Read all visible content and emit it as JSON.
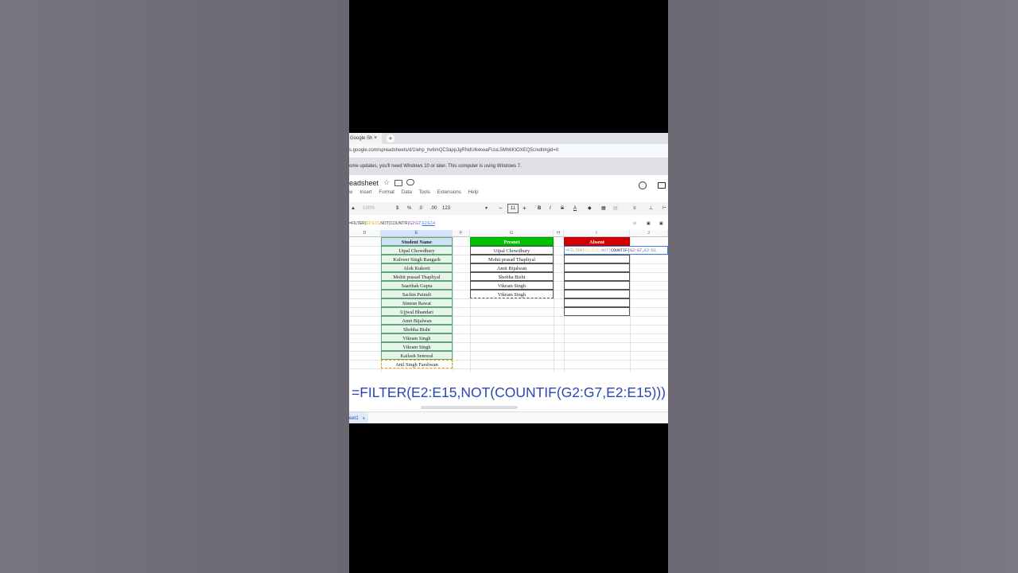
{
  "browser": {
    "tab_label": "Google Sh",
    "tab_close": "×",
    "new_tab": "+",
    "url": "s.google.com/spreadsheets/d/1lehp_hv6mQC3appJgRNdU6xkwaFUuL5Mh6KtOXEQ5c/edit#gid=0",
    "info_message": "ome updates, you'll need Windows 10 or later. This computer is using Windows 7."
  },
  "doc": {
    "title": "eadsheet",
    "star": "☆",
    "menu": [
      "w",
      "Insert",
      "Format",
      "Data",
      "Tools",
      "Extensions",
      "Help"
    ]
  },
  "toolbar": {
    "zoom": "100%",
    "currency": "$",
    "percent": "%",
    "dec_less": ".0",
    "dec_more": ".00",
    "format_123": "123",
    "minus": "−",
    "font_size": "11",
    "plus": "+",
    "bold": "B",
    "italic": "I",
    "strike": "S",
    "text_color": "A"
  },
  "formula_bar": {
    "parts": [
      "=FILTER(",
      "E2:E15",
      ",NOT(COUNTIF(",
      "G2:G7",
      ",",
      "E2:E14"
    ]
  },
  "columns": [
    "D",
    "E",
    "F",
    "G",
    "H",
    "I",
    "J"
  ],
  "student_header": "Student Name",
  "students": [
    "Utpal Chowdhury",
    "Kulveer Singh Rangarh",
    "Alok Kukreti",
    "Mohit prasad Thapliyal",
    "Saarthak Gupta",
    "Sachin Painuli",
    "Simran Rawat",
    "Ujjwal Bhandari",
    "Amit Bijalwan",
    "Shobha Bisht",
    "Vikram Singh",
    "Vikram Singh",
    "Kailash Semwal",
    "Anil Singh Farshwan"
  ],
  "present_header": "Presnet",
  "present": [
    "Utpal Chowdhury",
    "Mohit prasad Thapliyal",
    "Amit Bijalwan",
    "Shobha Bisht",
    "Vikram Singh",
    "Vikram Singh"
  ],
  "absent_header": "Absent",
  "absent_edit": {
    "parts": [
      "=FILTER(",
      "E2:E15",
      ",NOT(",
      "COUNTIF(",
      "G2:G7",
      ",",
      "E2:E1"
    ]
  },
  "caption": "=FILTER(E2:E15,NOT(COUNTIF(G2:G7,E2:E15)))",
  "sheet_tab": "eet1",
  "colors": {
    "present_header": "#00c000",
    "absent_header": "#d40000",
    "student_header": "#cfe2f3",
    "caption": "#2b47b6",
    "range_orange": "#e8a317",
    "range_blue": "#3b7dd8"
  }
}
